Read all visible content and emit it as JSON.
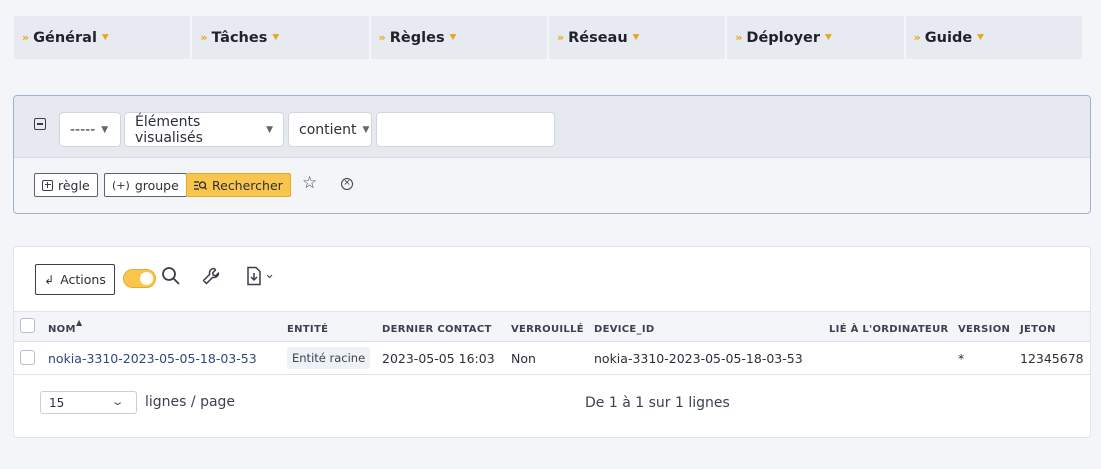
{
  "menu": {
    "items": [
      {
        "label": "Général"
      },
      {
        "label": "Tâches"
      },
      {
        "label": "Règles"
      },
      {
        "label": "Réseau"
      },
      {
        "label": "Déployer"
      },
      {
        "label": "Guide"
      }
    ]
  },
  "search": {
    "field_select": "-----",
    "column_select": "Éléments visualisés",
    "operator_select": "contient",
    "value_input": "",
    "add_rule_label": "règle",
    "add_group_label": "groupe",
    "search_label": "Rechercher"
  },
  "toolbar": {
    "actions_label": "Actions",
    "toggle_on": true
  },
  "table": {
    "columns": [
      "NOM",
      "ENTITÉ",
      "DERNIER CONTACT",
      "VERROUILLÉ",
      "DEVICE_ID",
      "LIÉ À L'ORDINATEUR",
      "VERSION",
      "JETON"
    ],
    "rows": [
      {
        "name": "nokia-3310-2023-05-05-18-03-53",
        "entity": "Entité racine",
        "last_contact": "2023-05-05 16:03",
        "locked": "Non",
        "device_id": "nokia-3310-2023-05-05-18-03-53",
        "linked_computer": "",
        "version": "*",
        "token": "12345678"
      }
    ]
  },
  "pager": {
    "per_page": "15",
    "per_page_label": "lignes / page",
    "info": "De 1 à 1 sur 1 lignes"
  },
  "colors": {
    "accent": "#f9c54d",
    "menu_chevron": "#e6a817",
    "link": "#2c4a7a"
  }
}
